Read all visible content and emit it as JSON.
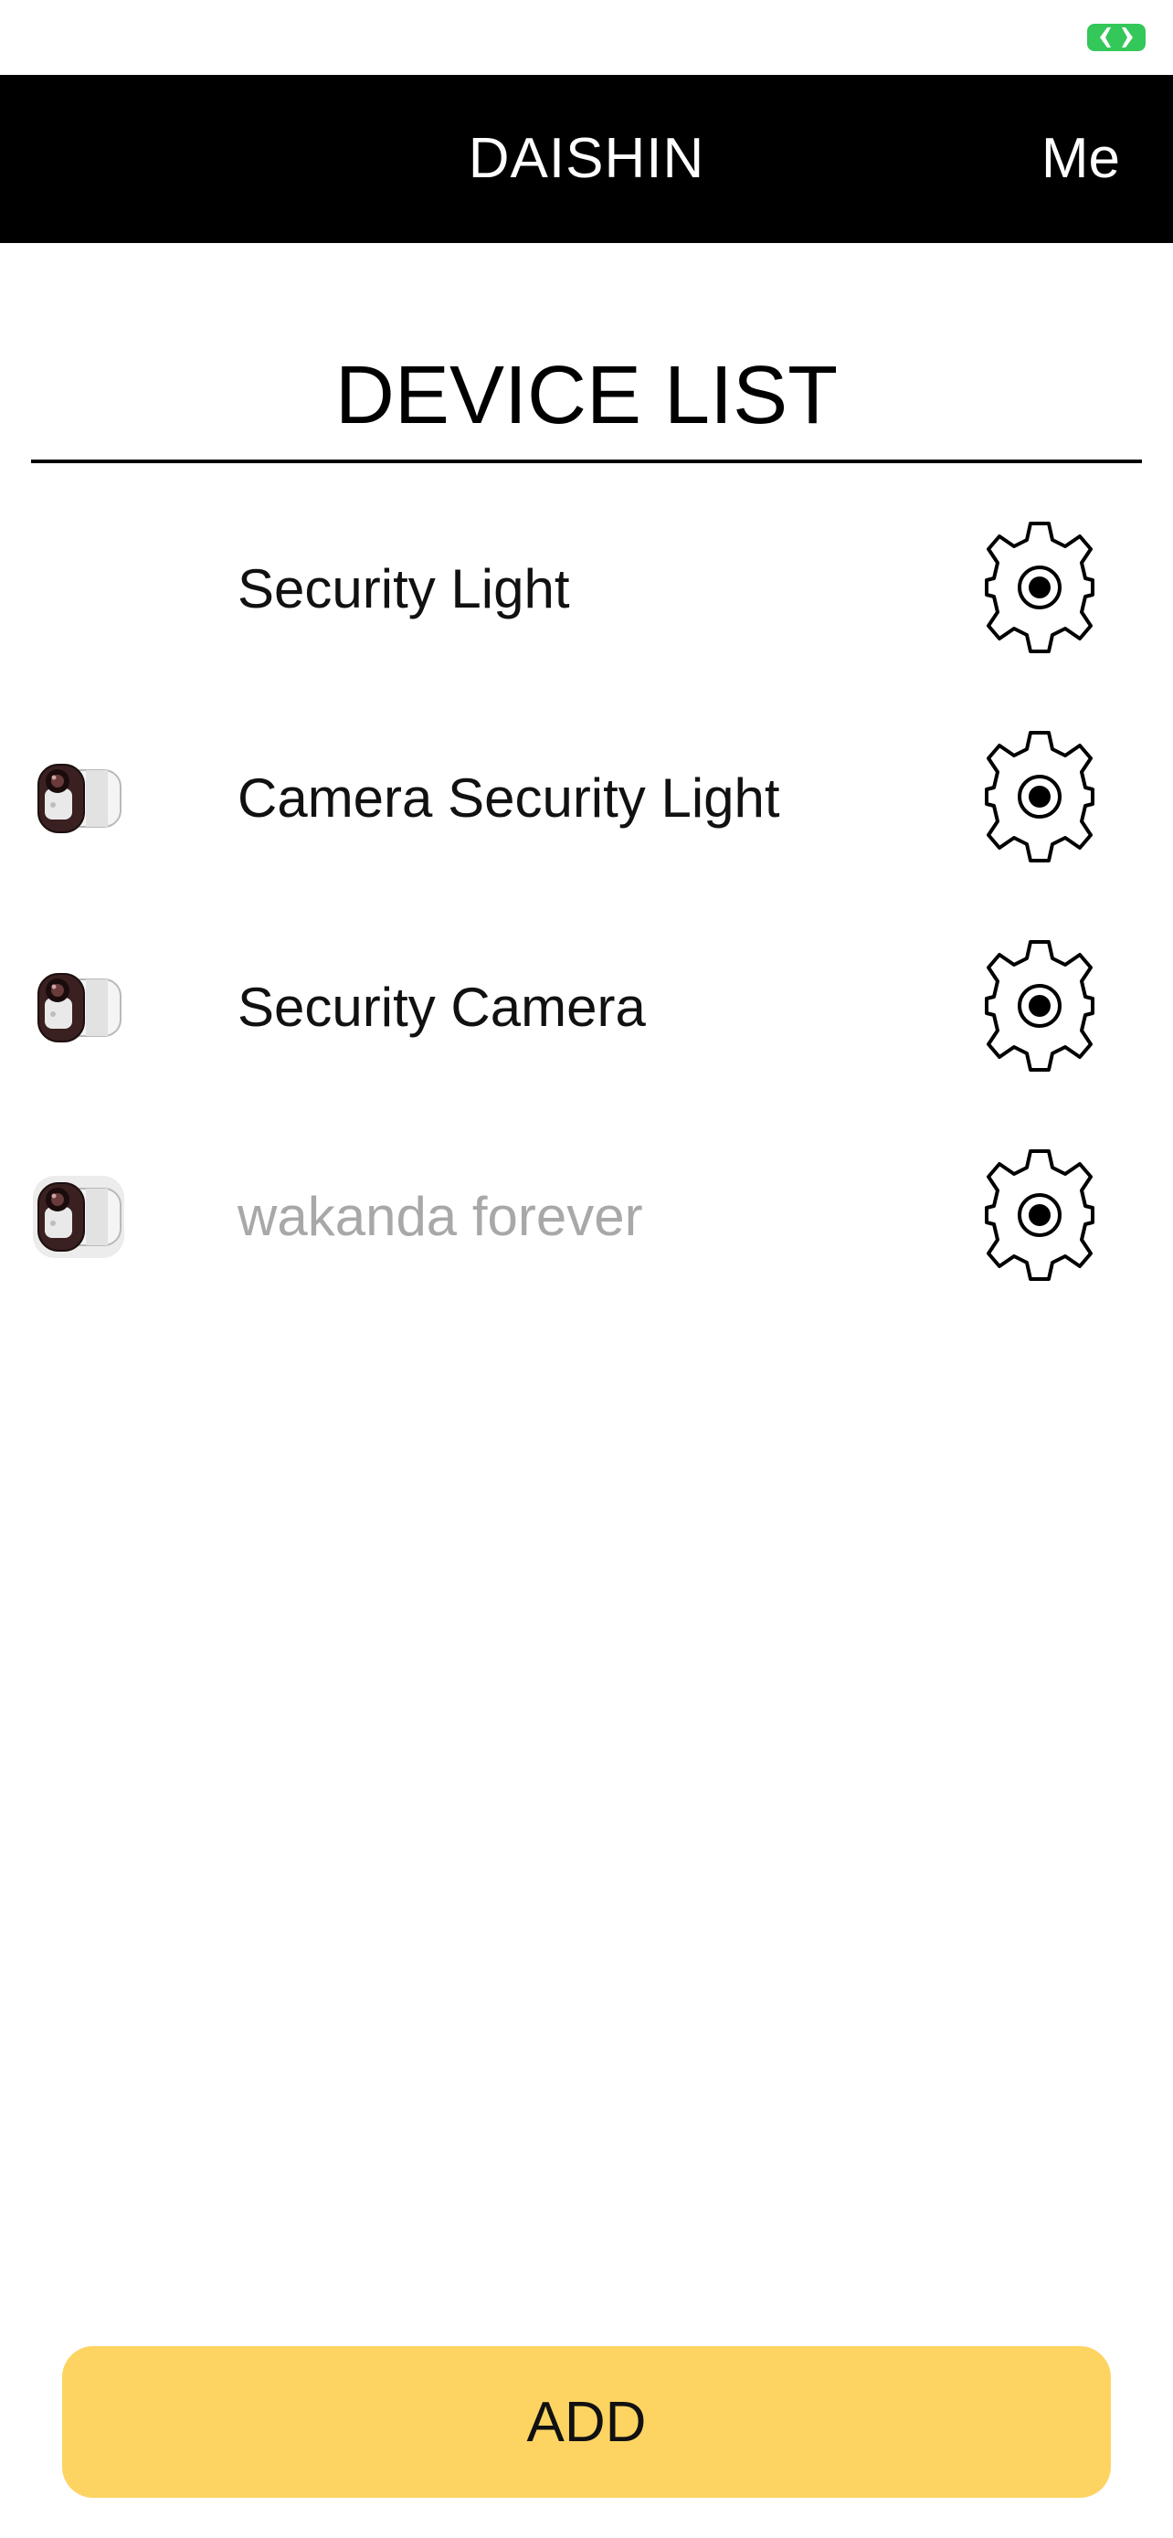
{
  "status_bar": {
    "indicator_icon": "battery-charging-icon",
    "indicator_color": "#34c759"
  },
  "nav": {
    "title": "DAISHIN",
    "me_label": "Me"
  },
  "section": {
    "title": "DEVICE LIST"
  },
  "devices": [
    {
      "name": "Security Light",
      "thumbnail": "none",
      "status": "online"
    },
    {
      "name": "Camera Security Light",
      "thumbnail": "camera-device-icon",
      "status": "online"
    },
    {
      "name": "Security Camera",
      "thumbnail": "camera-device-icon",
      "status": "online"
    },
    {
      "name": "wakanda forever",
      "thumbnail": "camera-device-icon",
      "status": "offline"
    }
  ],
  "settings_icon": "gear-icon",
  "add_button": {
    "label": "ADD",
    "color": "#fdd462"
  }
}
